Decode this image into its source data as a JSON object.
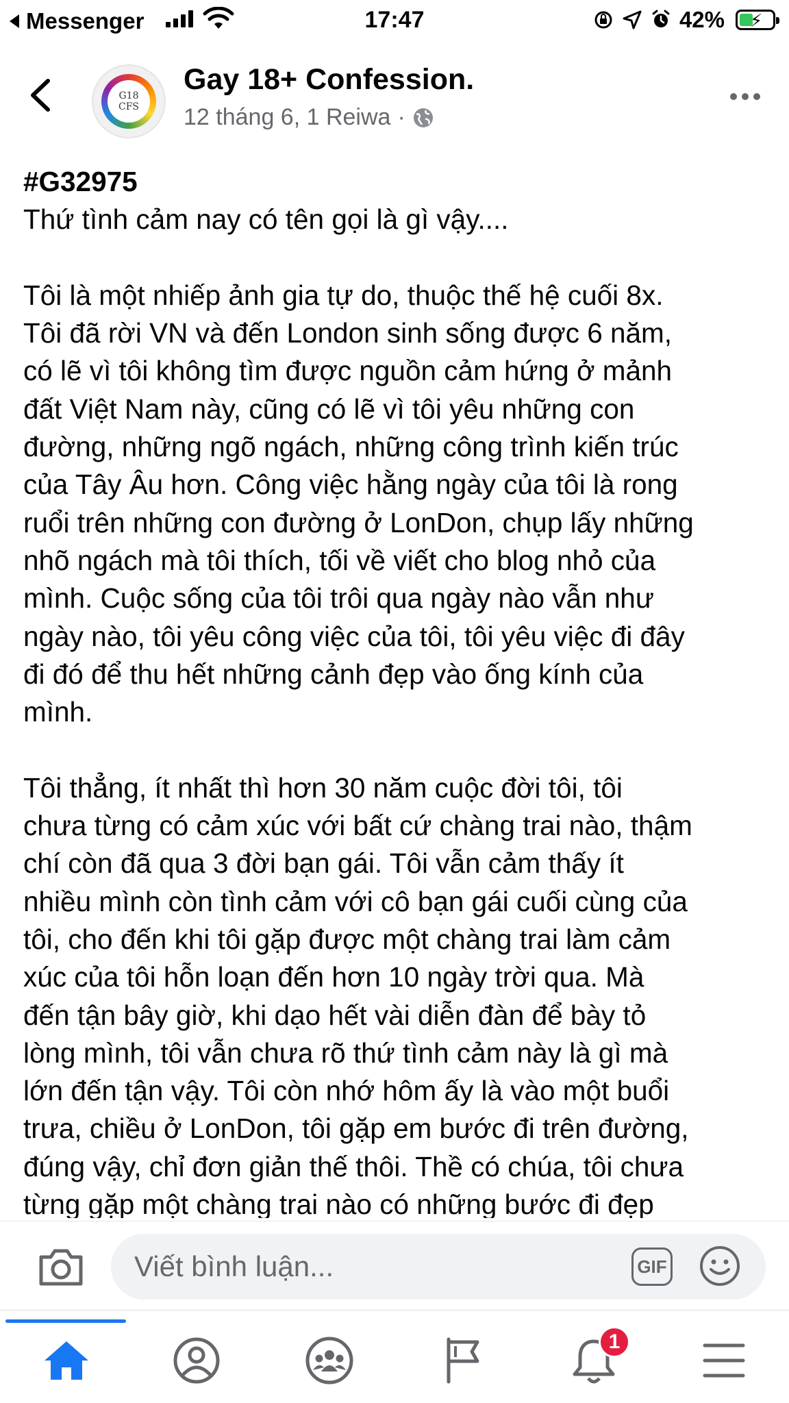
{
  "status_bar": {
    "back_app": "Messenger",
    "time": "17:47",
    "battery": "42%",
    "battery_level": 0.42
  },
  "header": {
    "page_name": "Gay 18+ Confession.",
    "date": "12 tháng 6, 1 Reiwa",
    "separator": "·",
    "avatar_text": "G18\nCFS",
    "back_icon": "chevron-left-icon",
    "more_icon": "more-horizontal-icon",
    "privacy_icon": "globe-icon"
  },
  "post": {
    "tag": "#G32975",
    "lines_p1": [
      "Thứ tình cảm nay có tên gọi là gì vậy...."
    ],
    "lines_p2": [
      "Tôi là một nhiếp ảnh gia tự do, thuộc thế hệ cuối 8x.",
      "Tôi đã rời VN và đến London sinh sống được 6 năm,",
      "có lẽ vì tôi không tìm được nguồn cảm hứng ở mảnh",
      "đất Việt Nam này, cũng có lẽ vì tôi yêu những con",
      "đường, những ngõ ngách, những công trình kiến trúc",
      "của Tây Âu hơn. Công việc hằng ngày của tôi là rong",
      "ruổi trên những con đường ở LonDon, chụp lấy những",
      "nhõ ngách mà tôi thích, tối về viết cho blog nhỏ của",
      "mình. Cuộc sống của tôi trôi qua ngày nào vẫn như",
      "ngày nào, tôi yêu công việc của tôi, tôi yêu việc đi đây",
      "đi đó để thu hết những cảnh đẹp vào ống kính của",
      "mình."
    ],
    "lines_p3": [
      "Tôi thẳng, ít nhất thì hơn 30 năm cuộc đời tôi, tôi",
      "chưa từng có cảm xúc với bất cứ chàng trai nào, thậm",
      "chí còn đã qua 3 đời bạn gái. Tôi vẫn cảm thấy ít",
      "nhiều mình còn tình cảm với cô bạn gái cuối cùng của",
      "tôi, cho đến khi tôi gặp được một chàng trai làm cảm",
      "xúc của tôi hỗn loạn đến hơn 10 ngày trời qua. Mà",
      "đến tận bây giờ, khi dạo hết vài diễn đàn để bày tỏ",
      "lòng mình, tôi vẫn chưa rõ thứ tình cảm này là gì mà",
      "lớn đến tận vậy.   Tôi còn nhớ hôm ấy là vào một buổi",
      "trưa, chiều ở LonDon, tôi gặp em bước đi trên đường,",
      "đúng vậy, chỉ đơn giản thế thôi. Thề có chúa, tôi chưa",
      "từng gặp một chàng trai nào có những bước đi đẹp"
    ]
  },
  "comment_bar": {
    "placeholder": "Viết bình luận...",
    "gif_label": "GIF",
    "camera_icon": "camera-icon",
    "emoji_icon": "emoji-icon"
  },
  "bottom_nav": {
    "items": [
      {
        "name": "home",
        "icon": "home-icon",
        "active": true
      },
      {
        "name": "profile",
        "icon": "profile-icon"
      },
      {
        "name": "groups",
        "icon": "groups-icon"
      },
      {
        "name": "pages",
        "icon": "flag-icon"
      },
      {
        "name": "notifications",
        "icon": "bell-icon",
        "badge": "1"
      },
      {
        "name": "menu",
        "icon": "menu-icon"
      }
    ],
    "notification_badge": "1"
  },
  "colors": {
    "accent": "#1877f2",
    "badge": "#e41e3f",
    "text_primary": "#050505",
    "text_secondary": "#65676b",
    "battery_fill": "#34c759"
  }
}
